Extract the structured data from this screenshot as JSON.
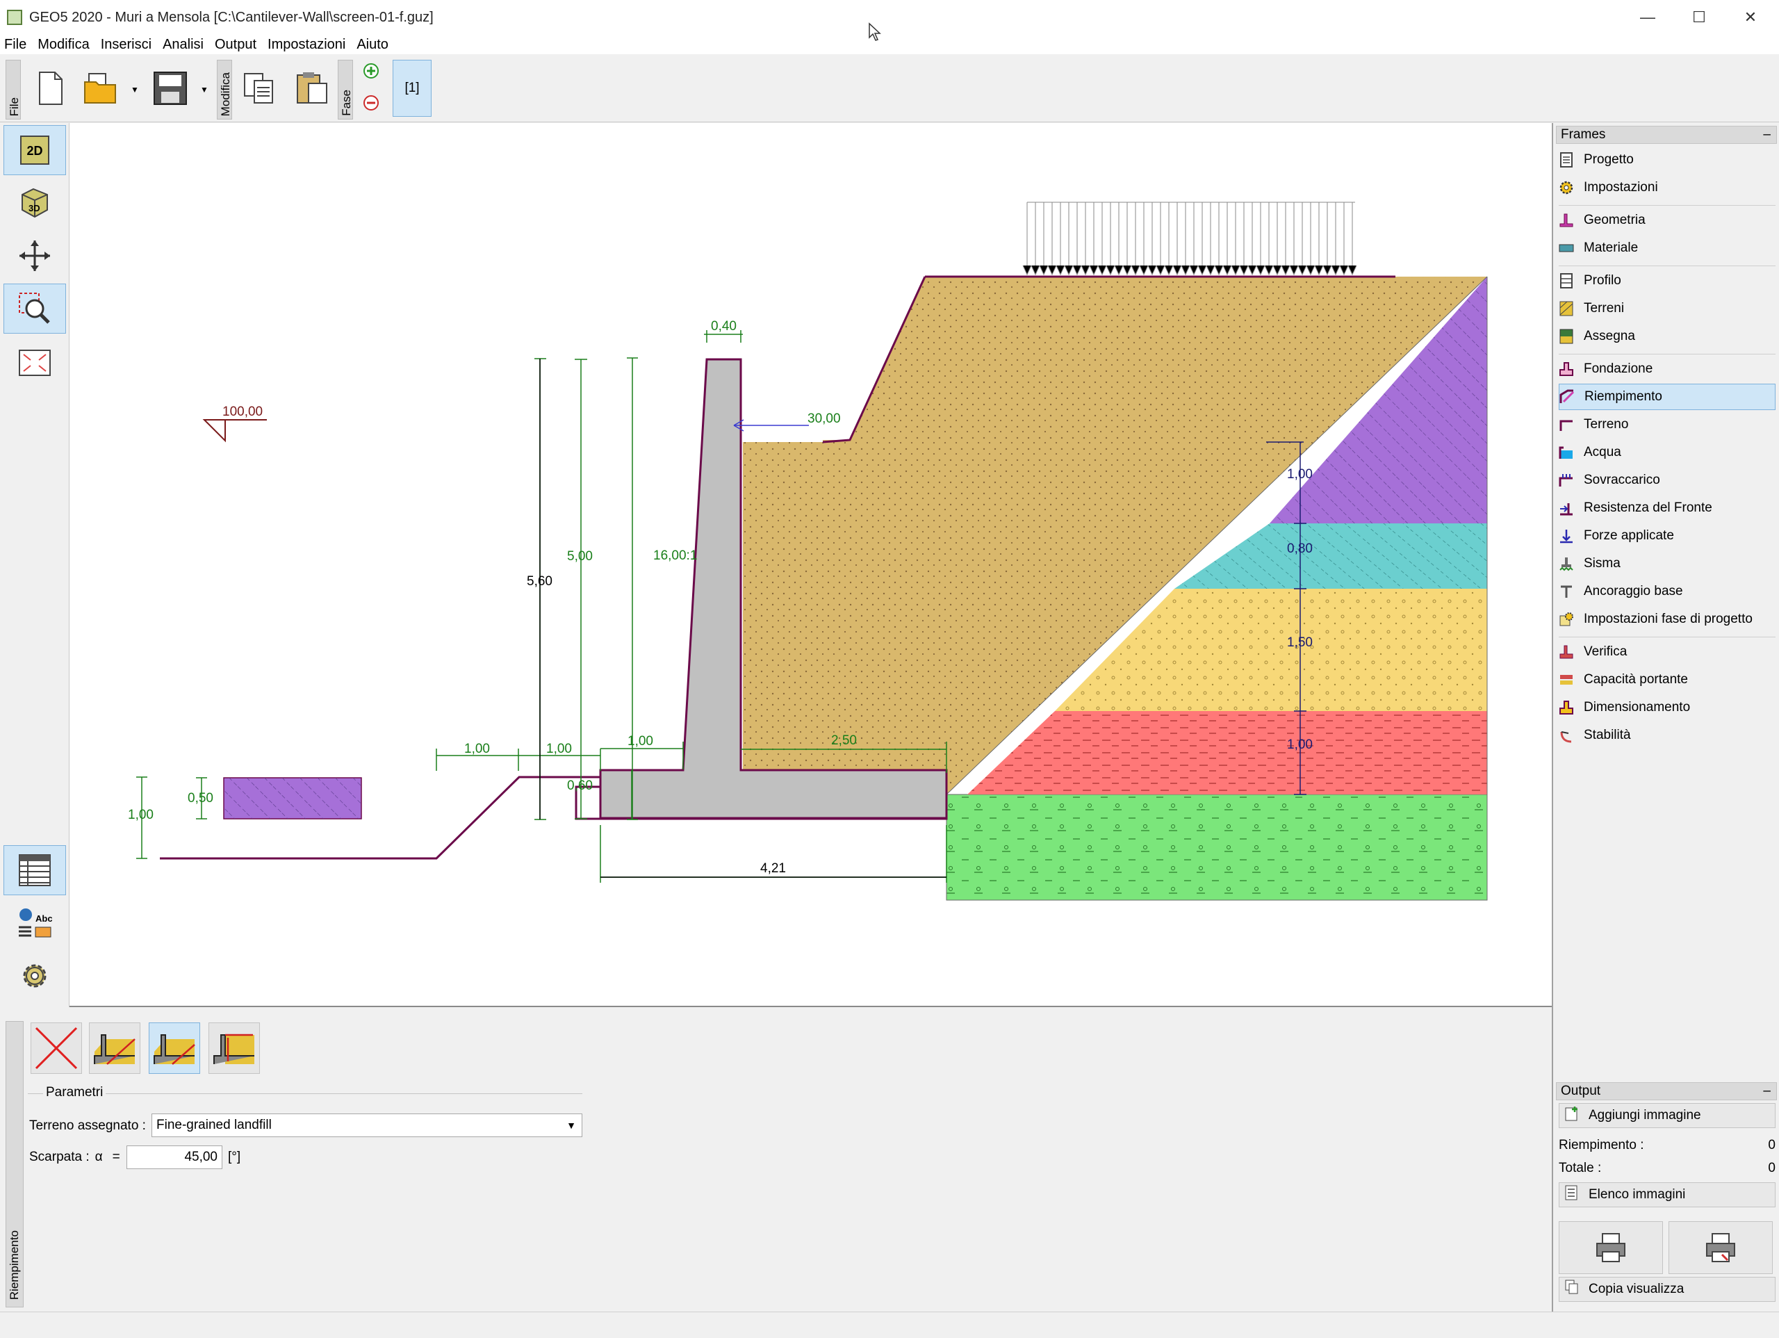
{
  "window": {
    "title": "GEO5 2020 - Muri a Mensola  [C:\\Cantilever-Wall\\screen-01-f.guz]",
    "minimize": "—",
    "maximize": "☐",
    "close": "✕"
  },
  "menu": [
    "File",
    "Modifica",
    "Inserisci",
    "Analisi",
    "Output",
    "Impostazioni",
    "Aiuto"
  ],
  "toolbar": {
    "file_tab": "File",
    "modifica_tab": "Modifica",
    "fase_tab": "Fase",
    "phase": "[1]"
  },
  "left_tools": {
    "btn2d": "2D",
    "btn3d": "3D"
  },
  "drawing": {
    "dims": {
      "top_width": "0,40",
      "wall_height": "5,00",
      "total_height": "5,60",
      "batter": "16,00:1",
      "slope_angle": "30,00",
      "elevation": "100,00",
      "front_a": "1,00",
      "front_b": "1,00",
      "toe": "1,00",
      "heel": "2,50",
      "base_thk": "0,60",
      "base_width": "4,21",
      "left_depth": "1,00",
      "left_block": "0,50",
      "layer1": "1,00",
      "layer2": "0,80",
      "layer3": "1,50",
      "layer4": "1,00"
    },
    "colors": {
      "backfill": "#d9b86c",
      "violet": "#a670d8",
      "cyan": "#6bcfcf",
      "yellow": "#f7d878",
      "red": "#ff7878",
      "green": "#7be67b",
      "wall": "#c0c0c0",
      "dim": "#1a7f1a",
      "outline": "#6b0a4a"
    }
  },
  "frames": {
    "header": "Frames",
    "collapse": "–",
    "items": [
      "Progetto",
      "Impostazioni",
      "Geometria",
      "Materiale",
      "Profilo",
      "Terreni",
      "Assegna",
      "Fondazione",
      "Riempimento",
      "Terreno",
      "Acqua",
      "Sovraccarico",
      "Resistenza del Fronte",
      "Forze applicate",
      "Sisma",
      "Ancoraggio base",
      "Impostazioni fase di progetto",
      "Verifica",
      "Capacità portante",
      "Dimensionamento",
      "Stabilità"
    ],
    "selected": "Riempimento"
  },
  "output": {
    "header": "Output",
    "collapse": "–",
    "add_image": "Aggiungi immagine",
    "row1_label": "Riempimento :",
    "row1_value": "0",
    "row2_label": "Totale :",
    "row2_value": "0",
    "list_images": "Elenco immagini",
    "copy_view": "Copia  visualizza"
  },
  "bottom": {
    "tab": "Riempimento",
    "group": "Parametri",
    "soil_label": "Terreno assegnato :",
    "soil_value": "Fine-grained landfill",
    "slope_label": "Scarpata :",
    "alpha": "α",
    "eq": "=",
    "slope_value": "45,00",
    "slope_unit": "[°]"
  }
}
